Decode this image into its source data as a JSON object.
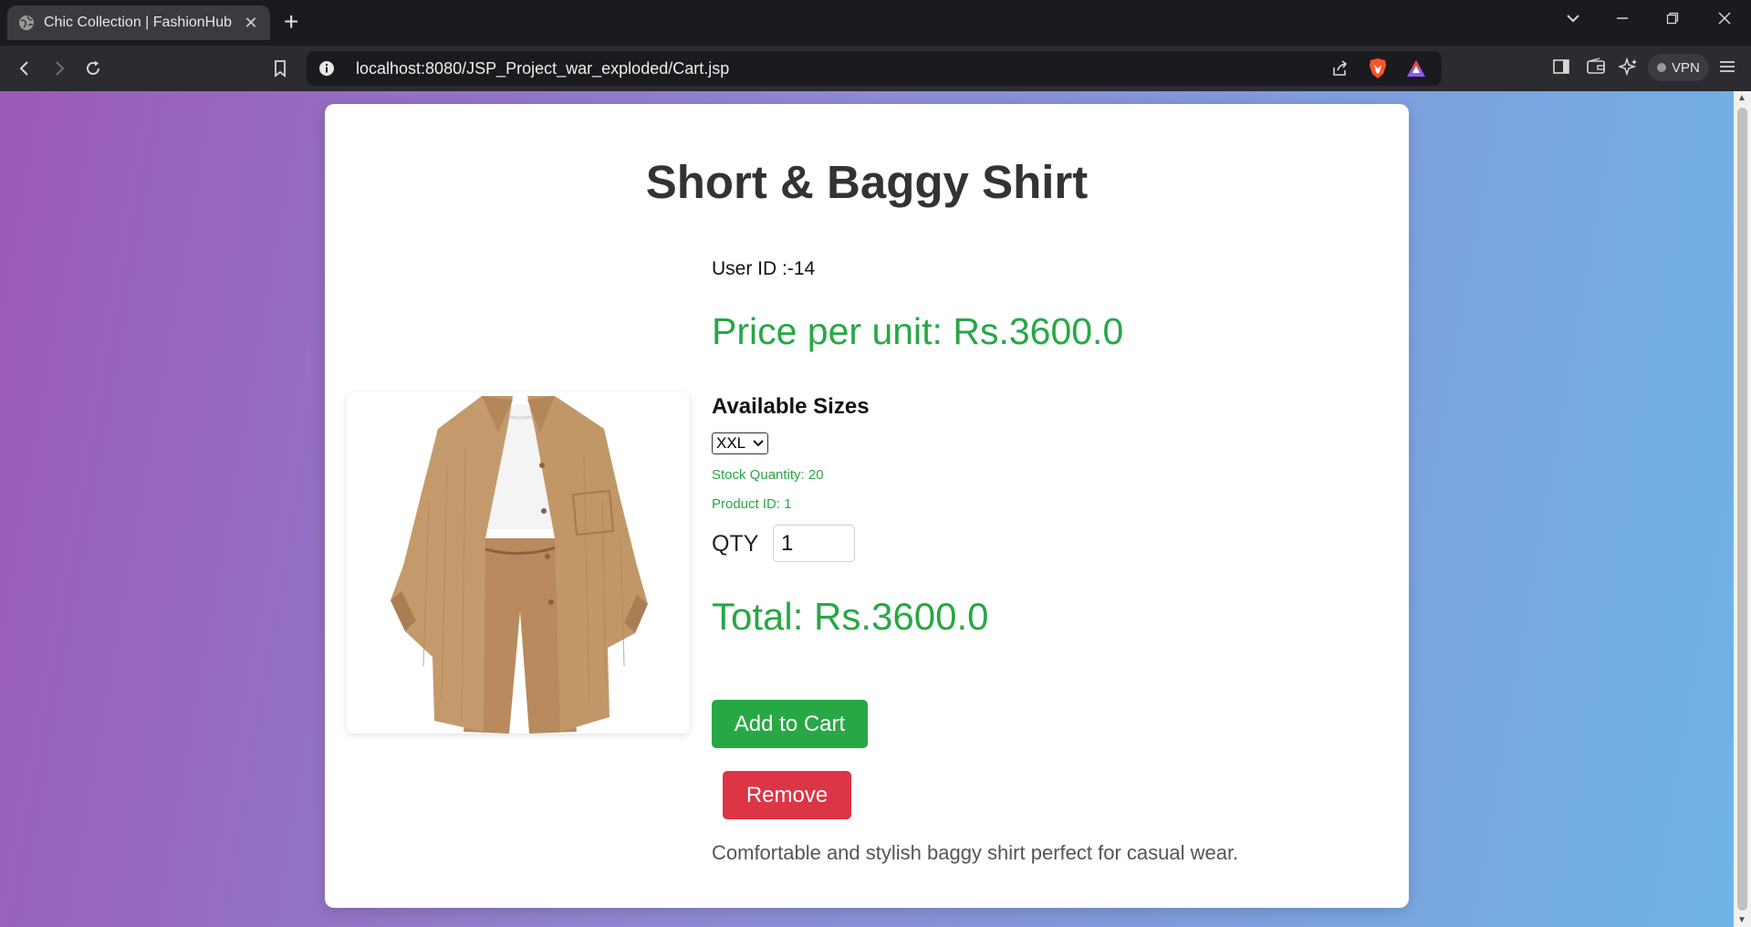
{
  "browser": {
    "tab_title": "Chic Collection | FashionHub",
    "tab_close": "✕",
    "new_tab": "+",
    "url": "localhost:8080/JSP_Project_war_exploded/Cart.jsp",
    "vpn_label": "VPN"
  },
  "product": {
    "title": "Short & Baggy Shirt",
    "user_id": "User ID :-14",
    "price_per_unit": "Price per unit: Rs.3600.0",
    "sizes_heading": "Available Sizes",
    "selected_size": "XXL",
    "stock": "Stock Quantity: 20",
    "product_id": "Product ID: 1",
    "qty_label": "QTY",
    "qty_value": "1",
    "total": "Total: Rs.3600.0",
    "add_button": "Add to Cart",
    "remove_button": "Remove",
    "description": "Comfortable and stylish baggy shirt perfect for casual wear."
  },
  "colors": {
    "price_green": "#28a745",
    "remove_red": "#dc3545",
    "gradient_start": "#9b59b6",
    "gradient_end": "#6fb4e6"
  }
}
